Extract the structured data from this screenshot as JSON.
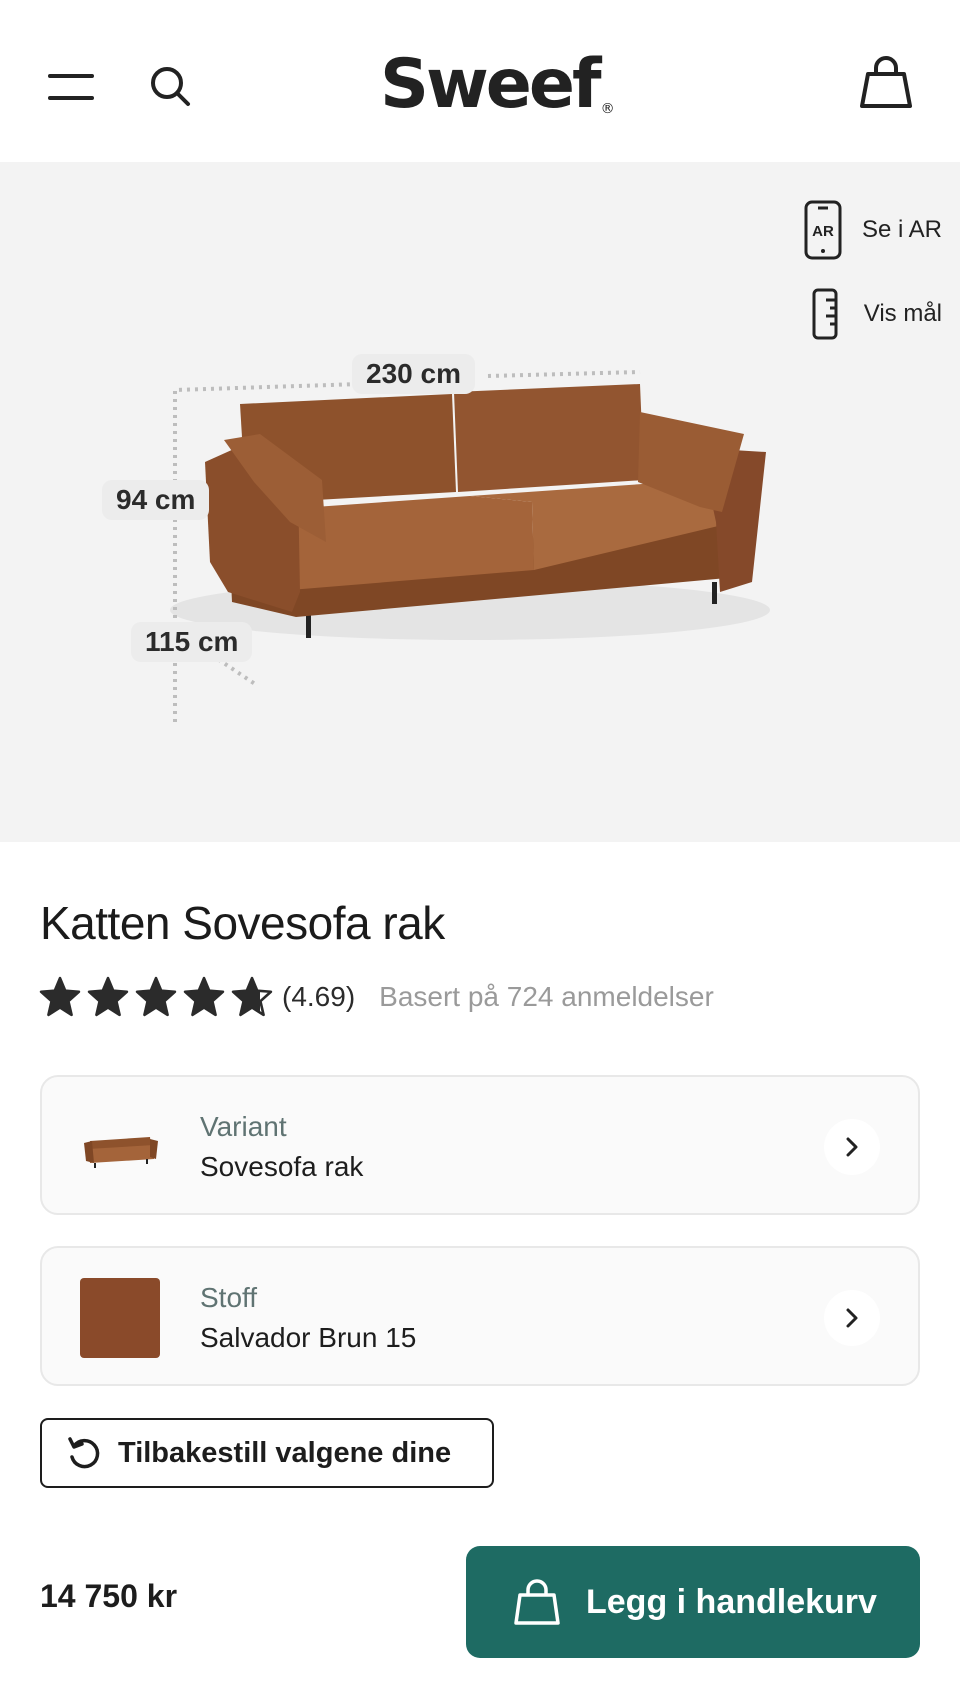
{
  "header": {
    "logo_text": "Sweef",
    "logo_mark": "®",
    "icons": [
      "menu-icon",
      "search-icon",
      "shopping-bag-icon"
    ]
  },
  "hero": {
    "ar_label": "Se i AR",
    "ar_icon_text": "AR",
    "measure_label": "Vis mål",
    "dimensions": {
      "width": "230 cm",
      "height": "94 cm",
      "depth": "115 cm"
    },
    "sofa_color": "#9a5a32"
  },
  "product": {
    "title": "Katten Sovesofa rak",
    "rating": {
      "value_text": "(4.69)",
      "score": 4.69,
      "max": 5,
      "reviews_text": "Basert på 724 anmeldelser"
    },
    "options": [
      {
        "label": "Variant",
        "value": "Sovesofa rak",
        "thumb": "sofa-thumbnail"
      },
      {
        "label": "Stoff",
        "value": "Salvador Brun 15",
        "swatch_color": "#8a4a2a"
      }
    ],
    "reset_label": "Tilbakestill valgene dine"
  },
  "purchase": {
    "price": "14 750 kr",
    "add_to_cart_label": "Legg i handlekurv",
    "button_color": "#1e6b63"
  }
}
